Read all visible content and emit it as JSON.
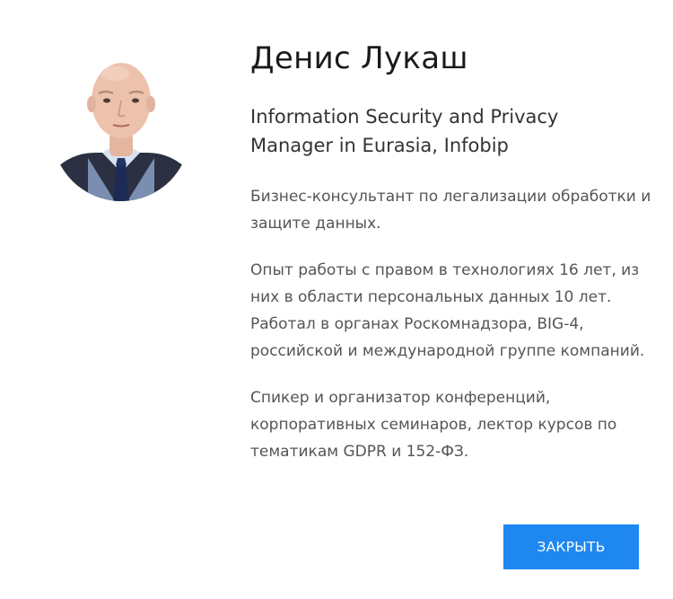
{
  "speaker": {
    "name": "Денис Лукаш",
    "position_line1": "Information Security and Privacy",
    "position_line2": "Manager in Eurasia, Infobip",
    "bio": [
      "Бизнес-консультант по легализации обработки и защите данных.",
      "Опыт работы с правом в технологиях 16 лет, из них в области персональных данных 10 лет. Работал в органах Роскомнадзора, BIG-4, российской и международной группе компаний.",
      "Спикер и организатор конференций, корпоративных семинаров, лектор курсов по тематикам GDPR и 152-ФЗ."
    ]
  },
  "actions": {
    "close_label": "ЗАКРЫТЬ"
  },
  "colors": {
    "accent": "#1e88f0"
  }
}
